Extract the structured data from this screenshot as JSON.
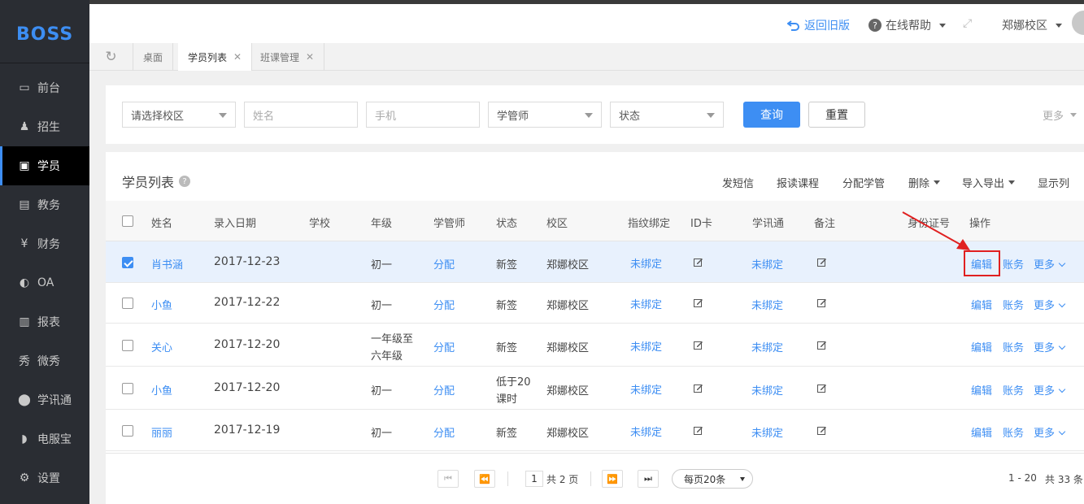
{
  "logo": "BOSS",
  "sidebar": {
    "items": [
      {
        "label": "前台",
        "icon": "monitor-icon"
      },
      {
        "label": "招生",
        "icon": "user-add-icon"
      },
      {
        "label": "学员",
        "icon": "student-card-icon"
      },
      {
        "label": "教务",
        "icon": "book-icon"
      },
      {
        "label": "财务",
        "icon": "yen-coin-icon"
      },
      {
        "label": "OA",
        "icon": "chat-bubble-icon"
      },
      {
        "label": "报表",
        "icon": "bar-chart-icon"
      },
      {
        "label": "微秀",
        "icon": "xiu-icon"
      },
      {
        "label": "学讯通",
        "icon": "location-pin-icon"
      },
      {
        "label": "电服宝",
        "icon": "phone-icon"
      },
      {
        "label": "设置",
        "icon": "gear-icon"
      }
    ],
    "active": "学员"
  },
  "header": {
    "back_old": "返回旧版",
    "help": "在线帮助",
    "campus": "郑娜校区"
  },
  "tabs": [
    {
      "label": "桌面"
    },
    {
      "label": "学员列表"
    },
    {
      "label": "班课管理"
    }
  ],
  "filter": {
    "campus_placeholder": "请选择校区",
    "name_placeholder": "姓名",
    "phone_placeholder": "手机",
    "manager": "学管师",
    "status": "状态",
    "query_label": "查询",
    "reset_label": "重置",
    "more_label": "更多"
  },
  "list": {
    "title": "学员列表",
    "toolbar": {
      "sms": "发短信",
      "enroll": "报读课程",
      "assign": "分配学管",
      "delete": "删除",
      "import_export": "导入导出",
      "columns": "显示列"
    },
    "columns": [
      "姓名",
      "录入日期",
      "学校",
      "年级",
      "学管师",
      "状态",
      "校区",
      "指纹绑定",
      "ID卡",
      "学讯通",
      "备注",
      "身份证号",
      "操作"
    ],
    "rows": [
      {
        "name": "肖书涵",
        "date": "2017-12-23",
        "grade": "初一",
        "grade2": "",
        "manager": "分配",
        "status": "新签",
        "status2": "",
        "campus": "郑娜校区",
        "finger": "未绑定",
        "xxt": "未绑定",
        "checked": true
      },
      {
        "name": "小鱼",
        "date": "2017-12-22",
        "grade": "初一",
        "grade2": "",
        "manager": "分配",
        "status": "新签",
        "status2": "",
        "campus": "郑娜校区",
        "finger": "未绑定",
        "xxt": "未绑定",
        "checked": false
      },
      {
        "name": "关心",
        "date": "2017-12-20",
        "grade": "一年级至",
        "grade2": "六年级",
        "manager": "分配",
        "status": "新签",
        "status2": "",
        "campus": "郑娜校区",
        "finger": "未绑定",
        "xxt": "未绑定",
        "checked": false
      },
      {
        "name": "小鱼",
        "date": "2017-12-20",
        "grade": "初一",
        "grade2": "",
        "manager": "分配",
        "status": "低于20",
        "status2": "课时",
        "campus": "郑娜校区",
        "finger": "未绑定",
        "xxt": "未绑定",
        "checked": false
      },
      {
        "name": "丽丽",
        "date": "2017-12-19",
        "grade": "初一",
        "grade2": "",
        "manager": "分配",
        "status": "新签",
        "status2": "",
        "campus": "郑娜校区",
        "finger": "未绑定",
        "xxt": "未绑定",
        "checked": false
      }
    ],
    "actions": {
      "edit": "编辑",
      "account": "账务",
      "more": "更多"
    }
  },
  "pager": {
    "page": "1",
    "total_pages": "共 2 页",
    "page_size": "每页20条",
    "range": "1 - 20",
    "total": "共 33 条"
  },
  "colors": {
    "accent": "#3d8ef3",
    "sidebar": "#2a2d33",
    "highlight": "#e02020"
  }
}
